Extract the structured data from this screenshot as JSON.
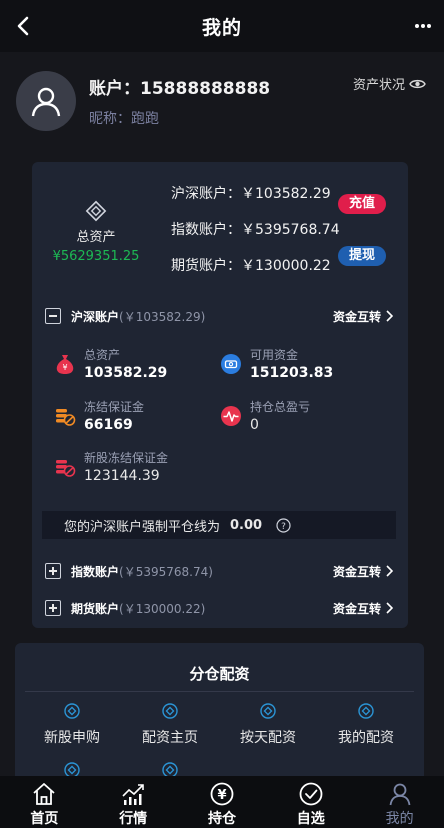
{
  "header": {
    "title": "我的"
  },
  "profile": {
    "account": "账户：15888888888",
    "nickname": "昵称：跑跑",
    "asset_status": "资产状况"
  },
  "summary": {
    "total_label": "总资产",
    "total_value": "¥5629351.25",
    "accounts": [
      {
        "label": "沪深账户：￥103582.29"
      },
      {
        "label": "指数账户：￥5395768.74"
      },
      {
        "label": "期货账户：￥130000.22"
      }
    ],
    "recharge_button": "充值",
    "withdraw_button": "提现"
  },
  "hushen": {
    "name": "沪深账户",
    "amount": "(￥103582.29)",
    "transfer": "资金互转",
    "stats": {
      "total_assets": {
        "label": "总资产",
        "value": "103582.29"
      },
      "available": {
        "label": "可用资金",
        "value": "151203.83"
      },
      "frozen_margin": {
        "label": "冻结保证金",
        "value": "66169"
      },
      "position_pnl": {
        "label": "持仓总盈亏",
        "value": "0"
      },
      "ipo_frozen": {
        "label": "新股冻结保证金",
        "value": "123144.39"
      }
    },
    "liquidation_text": "您的沪深账户强制平仓线为",
    "liquidation_value": "0.00"
  },
  "index_account": {
    "name": "指数账户",
    "amount": "(￥5395768.74)",
    "transfer": "资金互转"
  },
  "futures_account": {
    "name": "期货账户",
    "amount": "(￥130000.22)",
    "transfer": "资金互转"
  },
  "allocation": {
    "title": "分仓配资",
    "items": [
      {
        "label": "新股申购"
      },
      {
        "label": "配资主页"
      },
      {
        "label": "按天配资"
      },
      {
        "label": "我的配资"
      }
    ]
  },
  "tabbar": {
    "tabs": [
      {
        "label": "首页",
        "icon": "home-icon"
      },
      {
        "label": "行情",
        "icon": "chart-icon"
      },
      {
        "label": "持仓",
        "icon": "yen-coin-icon"
      },
      {
        "label": "自选",
        "icon": "check-circle-icon"
      },
      {
        "label": "我的",
        "icon": "user-icon"
      }
    ],
    "active": "我的"
  },
  "colors": {
    "background": "#16171c",
    "card": "#1f2533",
    "green": "#1db954",
    "red": "#e01e4b",
    "blue": "#1f5fb0",
    "muted": "#7b80a0"
  }
}
